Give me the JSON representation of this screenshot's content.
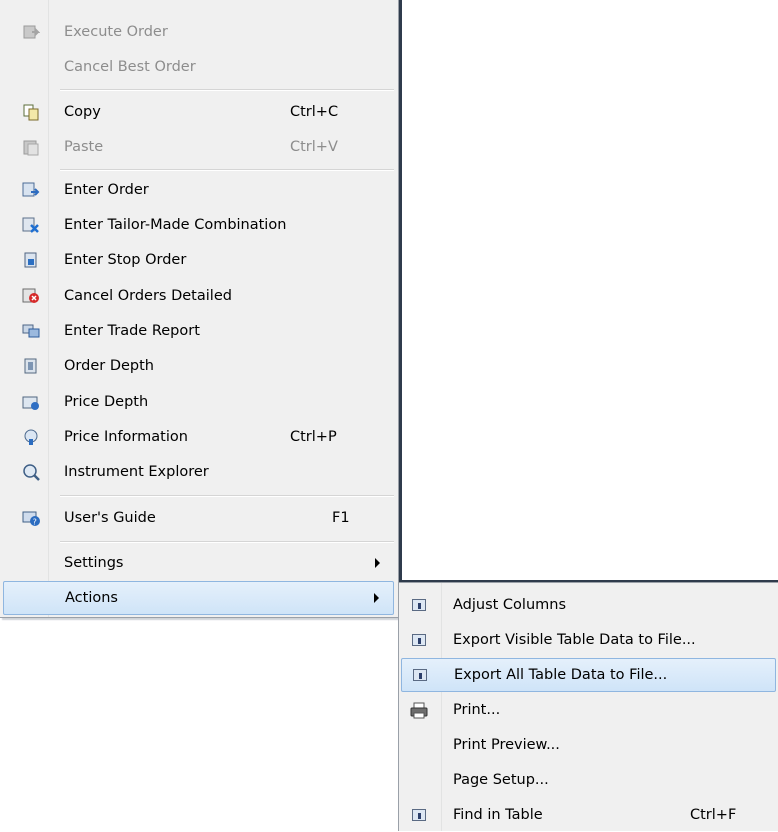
{
  "main_menu": {
    "items": [
      {
        "label": "Execute Order",
        "shortcut": "",
        "icon": "execute-order-icon",
        "disabled": true
      },
      {
        "label": "Cancel Best Order",
        "shortcut": "",
        "icon": "",
        "disabled": true
      },
      {
        "label": "Copy",
        "shortcut": "Ctrl+C",
        "icon": "copy-icon",
        "disabled": false
      },
      {
        "label": "Paste",
        "shortcut": "Ctrl+V",
        "icon": "paste-icon",
        "disabled": true
      },
      {
        "label": "Enter Order",
        "shortcut": "",
        "icon": "enter-order-icon",
        "disabled": false
      },
      {
        "label": "Enter Tailor-Made Combination",
        "shortcut": "",
        "icon": "tailor-made-combination-icon",
        "disabled": false
      },
      {
        "label": "Enter Stop Order",
        "shortcut": "",
        "icon": "stop-order-icon",
        "disabled": false
      },
      {
        "label": "Cancel Orders Detailed",
        "shortcut": "",
        "icon": "cancel-orders-icon",
        "disabled": false
      },
      {
        "label": "Enter Trade Report",
        "shortcut": "",
        "icon": "trade-report-icon",
        "disabled": false
      },
      {
        "label": "Order Depth",
        "shortcut": "",
        "icon": "order-depth-icon",
        "disabled": false
      },
      {
        "label": "Price Depth",
        "shortcut": "",
        "icon": "price-depth-icon",
        "disabled": false
      },
      {
        "label": "Price Information",
        "shortcut": "Ctrl+P",
        "icon": "price-information-icon",
        "disabled": false
      },
      {
        "label": "Instrument Explorer",
        "shortcut": "",
        "icon": "instrument-explorer-icon",
        "disabled": false
      },
      {
        "label": "User's Guide",
        "shortcut": "F1",
        "icon": "help-icon",
        "disabled": false
      },
      {
        "label": "Settings",
        "shortcut": "",
        "icon": "",
        "disabled": false,
        "submenu": true
      },
      {
        "label": "Actions",
        "shortcut": "",
        "icon": "",
        "disabled": false,
        "submenu": true,
        "selected": true
      }
    ]
  },
  "actions_submenu": {
    "items": [
      {
        "label": "Adjust Columns",
        "shortcut": "",
        "icon": "table-icon"
      },
      {
        "label": "Export Visible Table Data to File...",
        "shortcut": "",
        "icon": "table-icon"
      },
      {
        "label": "Export All Table Data to File...",
        "shortcut": "",
        "icon": "table-icon",
        "selected": true
      },
      {
        "label": "Print...",
        "shortcut": "",
        "icon": "printer-icon"
      },
      {
        "label": "Print Preview...",
        "shortcut": "",
        "icon": ""
      },
      {
        "label": "Page Setup...",
        "shortcut": "",
        "icon": ""
      },
      {
        "label": "Find in Table",
        "shortcut": "Ctrl+F",
        "icon": "table-icon"
      }
    ]
  },
  "colors": {
    "menu_bg": "#f0f0f0",
    "selected_bg": "#d9e8f9",
    "selected_border": "#8fb6e0",
    "disabled_text": "#8d8d8d",
    "shadow": "#2f3b4c"
  }
}
